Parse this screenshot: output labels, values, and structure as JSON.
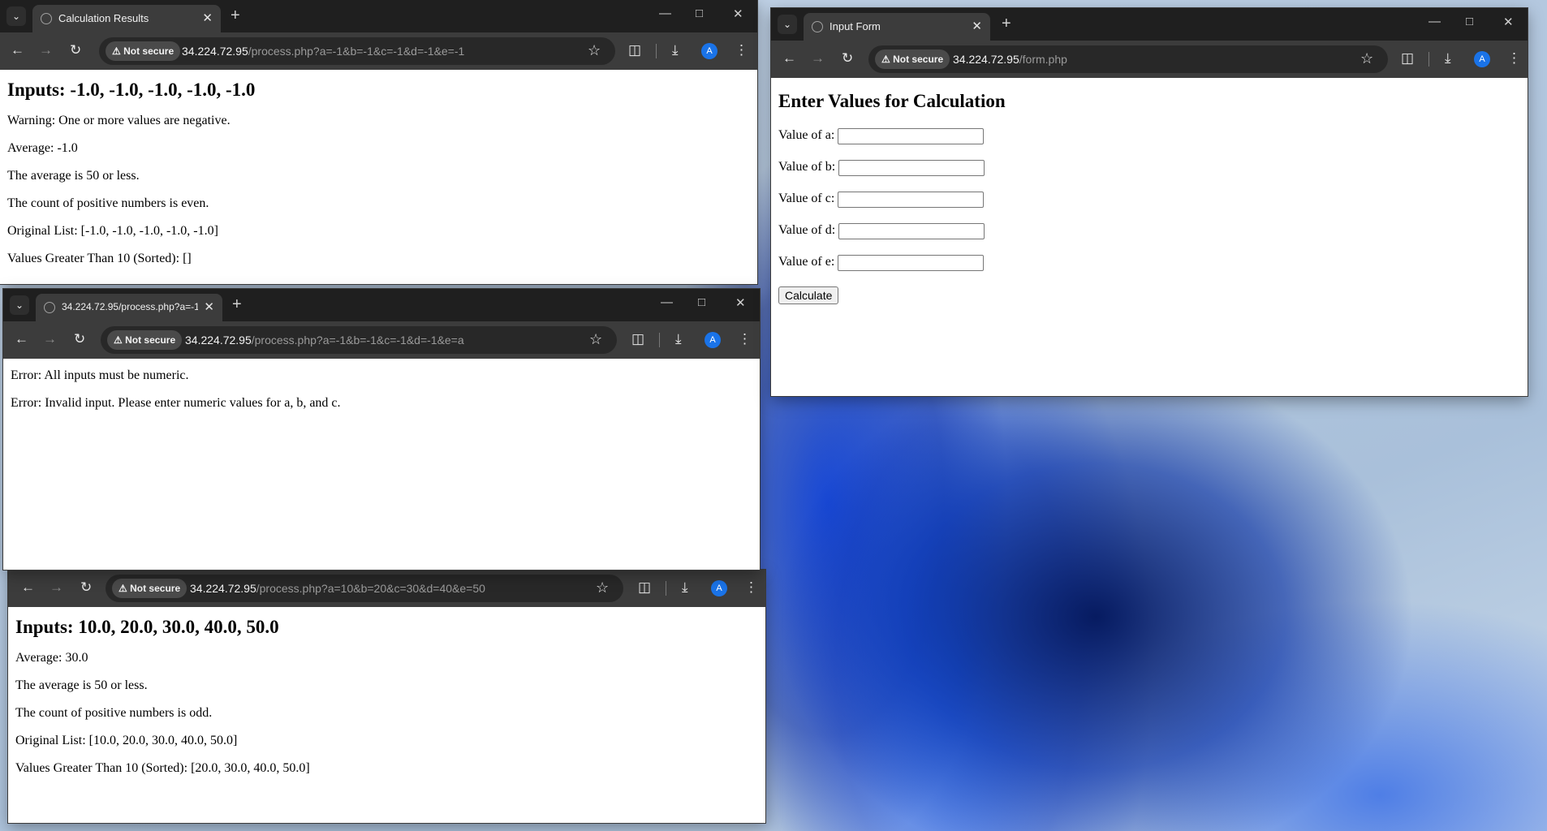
{
  "windows": {
    "calc_results": {
      "tab_title": "Calculation Results",
      "security_label": "Not secure",
      "url_host": "34.224.72.95",
      "url_path": "/process.php?a=-1&b=-1&c=-1&d=-1&e=-1",
      "heading": "Inputs: -1.0, -1.0, -1.0, -1.0, -1.0",
      "lines": [
        "Warning: One or more values are negative.",
        "Average: -1.0",
        "The average is 50 or less.",
        "The count of positive numbers is even.",
        "Original List: [-1.0, -1.0, -1.0, -1.0, -1.0]",
        "Values Greater Than 10 (Sorted): []"
      ]
    },
    "error_window": {
      "tab_title": "34.224.72.95/process.php?a=-1",
      "security_label": "Not secure",
      "url_host": "34.224.72.95",
      "url_path": "/process.php?a=-1&b=-1&c=-1&d=-1&e=a",
      "lines": [
        "Error: All inputs must be numeric.",
        "Error: Invalid input. Please enter numeric values for a, b, and c."
      ]
    },
    "positive_results": {
      "security_label": "Not secure",
      "url_host": "34.224.72.95",
      "url_path": "/process.php?a=10&b=20&c=30&d=40&e=50",
      "heading": "Inputs: 10.0, 20.0, 30.0, 40.0, 50.0",
      "lines": [
        "Average: 30.0",
        "The average is 50 or less.",
        "The count of positive numbers is odd.",
        "Original List: [10.0, 20.0, 30.0, 40.0, 50.0]",
        "Values Greater Than 10 (Sorted): [20.0, 30.0, 40.0, 50.0]"
      ]
    },
    "input_form": {
      "tab_title": "Input Form",
      "security_label": "Not secure",
      "url_host": "34.224.72.95",
      "url_path": "/form.php",
      "heading": "Enter Values for Calculation",
      "fields": [
        "Value of a:",
        "Value of b:",
        "Value of c:",
        "Value of d:",
        "Value of e:"
      ],
      "submit_label": "Calculate"
    }
  },
  "profile_initial": "A",
  "icons": [
    "tab-search-icon",
    "globe-icon",
    "close-icon",
    "plus-icon",
    "minimize-icon",
    "maximize-icon",
    "back-arrow-icon",
    "forward-arrow-icon",
    "reload-icon",
    "warning-icon",
    "star-icon",
    "extensions-icon",
    "download-icon",
    "menu-icon"
  ],
  "desktop_accent": "#1a4fd8"
}
